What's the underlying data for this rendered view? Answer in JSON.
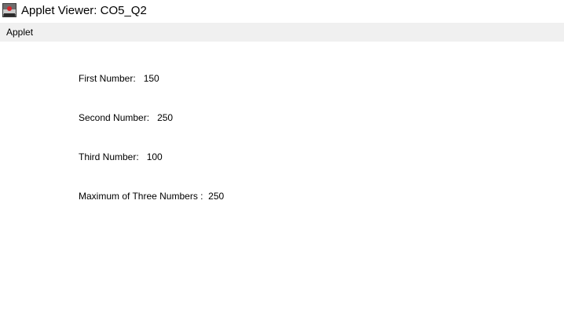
{
  "window": {
    "title": "Applet Viewer: CO5_Q2",
    "icon": "java-applet-icon"
  },
  "menubar": {
    "items": [
      {
        "label": "Applet"
      }
    ]
  },
  "applet": {
    "lines": [
      {
        "label": "First Number:",
        "value": "150"
      },
      {
        "label": "Second Number:",
        "value": "250"
      },
      {
        "label": "Third Number:",
        "value": "100"
      },
      {
        "label": "Maximum of Three Numbers :",
        "value": "250"
      }
    ]
  }
}
